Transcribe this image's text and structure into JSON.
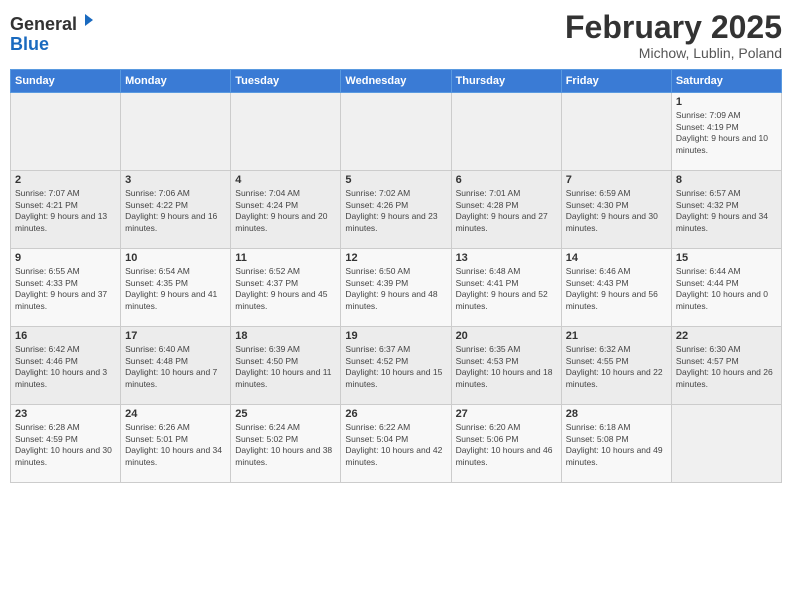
{
  "header": {
    "logo_general": "General",
    "logo_blue": "Blue",
    "month_title": "February 2025",
    "location": "Michow, Lublin, Poland"
  },
  "weekdays": [
    "Sunday",
    "Monday",
    "Tuesday",
    "Wednesday",
    "Thursday",
    "Friday",
    "Saturday"
  ],
  "weeks": [
    [
      {
        "day": "",
        "info": ""
      },
      {
        "day": "",
        "info": ""
      },
      {
        "day": "",
        "info": ""
      },
      {
        "day": "",
        "info": ""
      },
      {
        "day": "",
        "info": ""
      },
      {
        "day": "",
        "info": ""
      },
      {
        "day": "1",
        "info": "Sunrise: 7:09 AM\nSunset: 4:19 PM\nDaylight: 9 hours and 10 minutes."
      }
    ],
    [
      {
        "day": "2",
        "info": "Sunrise: 7:07 AM\nSunset: 4:21 PM\nDaylight: 9 hours and 13 minutes."
      },
      {
        "day": "3",
        "info": "Sunrise: 7:06 AM\nSunset: 4:22 PM\nDaylight: 9 hours and 16 minutes."
      },
      {
        "day": "4",
        "info": "Sunrise: 7:04 AM\nSunset: 4:24 PM\nDaylight: 9 hours and 20 minutes."
      },
      {
        "day": "5",
        "info": "Sunrise: 7:02 AM\nSunset: 4:26 PM\nDaylight: 9 hours and 23 minutes."
      },
      {
        "day": "6",
        "info": "Sunrise: 7:01 AM\nSunset: 4:28 PM\nDaylight: 9 hours and 27 minutes."
      },
      {
        "day": "7",
        "info": "Sunrise: 6:59 AM\nSunset: 4:30 PM\nDaylight: 9 hours and 30 minutes."
      },
      {
        "day": "8",
        "info": "Sunrise: 6:57 AM\nSunset: 4:32 PM\nDaylight: 9 hours and 34 minutes."
      }
    ],
    [
      {
        "day": "9",
        "info": "Sunrise: 6:55 AM\nSunset: 4:33 PM\nDaylight: 9 hours and 37 minutes."
      },
      {
        "day": "10",
        "info": "Sunrise: 6:54 AM\nSunset: 4:35 PM\nDaylight: 9 hours and 41 minutes."
      },
      {
        "day": "11",
        "info": "Sunrise: 6:52 AM\nSunset: 4:37 PM\nDaylight: 9 hours and 45 minutes."
      },
      {
        "day": "12",
        "info": "Sunrise: 6:50 AM\nSunset: 4:39 PM\nDaylight: 9 hours and 48 minutes."
      },
      {
        "day": "13",
        "info": "Sunrise: 6:48 AM\nSunset: 4:41 PM\nDaylight: 9 hours and 52 minutes."
      },
      {
        "day": "14",
        "info": "Sunrise: 6:46 AM\nSunset: 4:43 PM\nDaylight: 9 hours and 56 minutes."
      },
      {
        "day": "15",
        "info": "Sunrise: 6:44 AM\nSunset: 4:44 PM\nDaylight: 10 hours and 0 minutes."
      }
    ],
    [
      {
        "day": "16",
        "info": "Sunrise: 6:42 AM\nSunset: 4:46 PM\nDaylight: 10 hours and 3 minutes."
      },
      {
        "day": "17",
        "info": "Sunrise: 6:40 AM\nSunset: 4:48 PM\nDaylight: 10 hours and 7 minutes."
      },
      {
        "day": "18",
        "info": "Sunrise: 6:39 AM\nSunset: 4:50 PM\nDaylight: 10 hours and 11 minutes."
      },
      {
        "day": "19",
        "info": "Sunrise: 6:37 AM\nSunset: 4:52 PM\nDaylight: 10 hours and 15 minutes."
      },
      {
        "day": "20",
        "info": "Sunrise: 6:35 AM\nSunset: 4:53 PM\nDaylight: 10 hours and 18 minutes."
      },
      {
        "day": "21",
        "info": "Sunrise: 6:32 AM\nSunset: 4:55 PM\nDaylight: 10 hours and 22 minutes."
      },
      {
        "day": "22",
        "info": "Sunrise: 6:30 AM\nSunset: 4:57 PM\nDaylight: 10 hours and 26 minutes."
      }
    ],
    [
      {
        "day": "23",
        "info": "Sunrise: 6:28 AM\nSunset: 4:59 PM\nDaylight: 10 hours and 30 minutes."
      },
      {
        "day": "24",
        "info": "Sunrise: 6:26 AM\nSunset: 5:01 PM\nDaylight: 10 hours and 34 minutes."
      },
      {
        "day": "25",
        "info": "Sunrise: 6:24 AM\nSunset: 5:02 PM\nDaylight: 10 hours and 38 minutes."
      },
      {
        "day": "26",
        "info": "Sunrise: 6:22 AM\nSunset: 5:04 PM\nDaylight: 10 hours and 42 minutes."
      },
      {
        "day": "27",
        "info": "Sunrise: 6:20 AM\nSunset: 5:06 PM\nDaylight: 10 hours and 46 minutes."
      },
      {
        "day": "28",
        "info": "Sunrise: 6:18 AM\nSunset: 5:08 PM\nDaylight: 10 hours and 49 minutes."
      },
      {
        "day": "",
        "info": ""
      }
    ]
  ]
}
